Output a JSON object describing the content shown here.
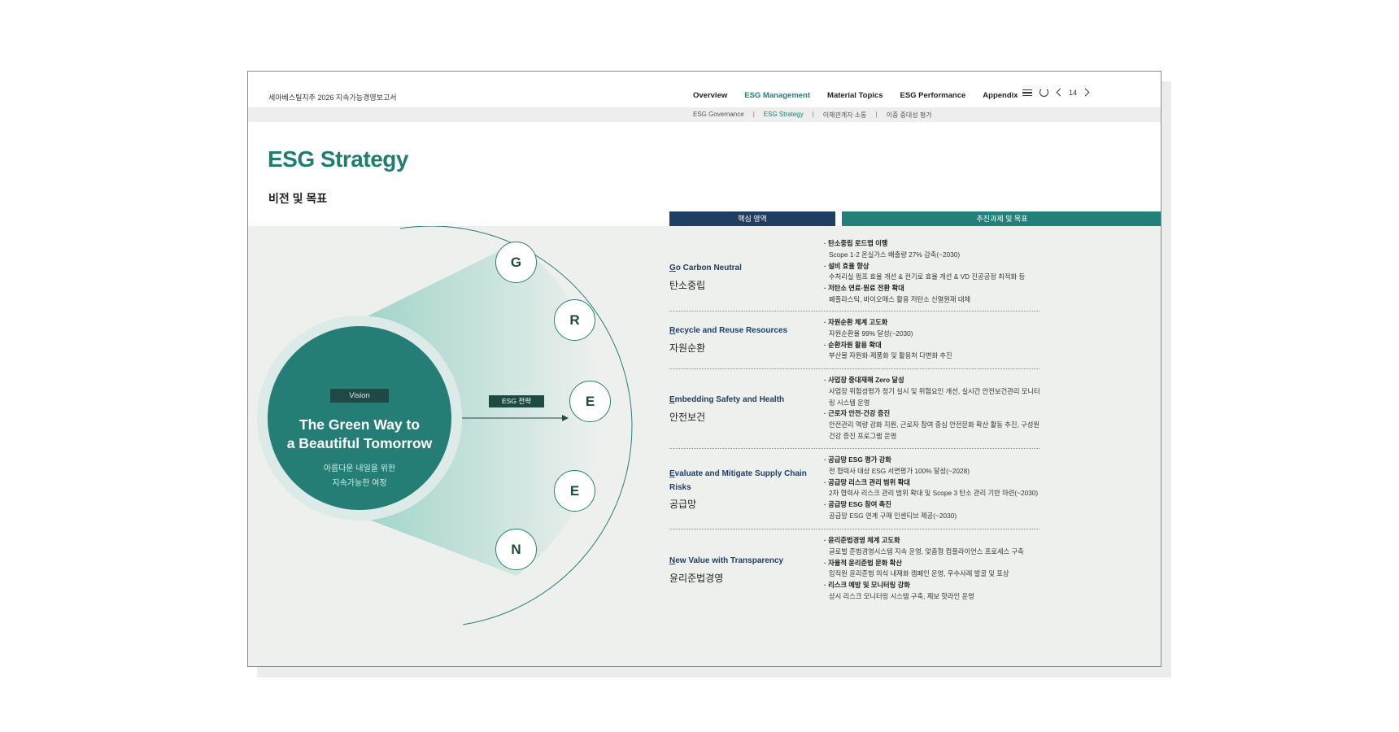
{
  "header": {
    "report_title": "세아베스틸지주 2026 지속가능경영보고서",
    "nav": [
      {
        "label": "Overview",
        "active": false
      },
      {
        "label": "ESG Management",
        "active": true
      },
      {
        "label": "Material Topics",
        "active": false
      },
      {
        "label": "ESG Performance",
        "active": false
      },
      {
        "label": "Appendix",
        "active": false
      }
    ],
    "page_number": "14",
    "icons": [
      "menu-icon",
      "refresh-icon",
      "chevron-left-icon",
      "chevron-right-icon"
    ]
  },
  "subnav": [
    {
      "label": "ESG Governance",
      "active": false
    },
    {
      "label": "ESG Strategy",
      "active": true
    },
    {
      "label": "이해관계자 소통",
      "active": false
    },
    {
      "label": "이중 중대성 평가",
      "active": false
    }
  ],
  "page": {
    "title": "ESG Strategy",
    "subtitle": "비전 및 목표"
  },
  "columns": {
    "core": "핵심 영역",
    "task": "추진과제 및 목표"
  },
  "vision": {
    "badge": "Vision",
    "title_line1": "The Green Way to",
    "title_line2": "a Beautiful Tomorrow",
    "sub_line1": "아름다운 내일을 위한",
    "sub_line2": "지속가능한 여정"
  },
  "strategy_tag": "ESG 전략",
  "letters": [
    "G",
    "R",
    "E",
    "E",
    "N"
  ],
  "rows": [
    {
      "en_first": "G",
      "en_rest": "o Carbon Neutral",
      "kr": "탄소중립",
      "items": [
        {
          "title": "· 탄소중립 로드맵 이행",
          "desc": "Scope 1·2  온실가스 배출량 27% 감축(~2030)"
        },
        {
          "title": "· 설비 효율 향상",
          "desc": "수처리실 펌프 효율 개선 & 전기로 효율 개선 & VD 진공공정 최적화 등"
        },
        {
          "title": "· 저탄소 연료·원료 전환 확대",
          "desc": "폐플라스틱, 바이오매스 활용 저탄소 신열원재 대체"
        }
      ]
    },
    {
      "en_first": "R",
      "en_rest": "ecycle and Reuse Resources",
      "kr": "자원순환",
      "items": [
        {
          "title": "· 자원순환 체계 고도화",
          "desc": "자원순환율 99% 달성(~2030)"
        },
        {
          "title": "· 순환자원 활용 확대",
          "desc": "부산물 자원화·제품화 및 활용처 다변화 추진"
        }
      ]
    },
    {
      "en_first": "E",
      "en_rest": "mbedding Safety and Health",
      "kr": "안전보건",
      "items": [
        {
          "title": "· 사업장 중대재해 Zero 달성",
          "desc": "사업장 위험성평가 정기 실시 및 위험요인 개선, 실시간 안전보건관리 모니터링 시스템 운영"
        },
        {
          "title": "· 근로자 안전·건강 증진",
          "desc": "안전관리 역량 강화 지원, 근로자 참여 중심 안전문화 확산 활동 추진, 구성원 건강 증진 프로그램 운영"
        }
      ]
    },
    {
      "en_first": "E",
      "en_rest": "valuate and Mitigate Supply Chain Risks",
      "kr": "공급망",
      "items": [
        {
          "title": "· 공급망 ESG 평가 강화",
          "desc": "전 협력사 대상 ESG 서면평가 100% 달성(~2028)"
        },
        {
          "title": "· 공급망 리스크 관리 범위 확대",
          "desc": "2차 협력사 리스크 관리 범위 확대 및 Scope 3 탄소 관리 기반 마련(~2030)"
        },
        {
          "title": "· 공급망 ESG 참여 촉진",
          "desc": "공급망 ESG 연계 구매 인센티브 제공(~2030)"
        }
      ]
    },
    {
      "en_first": "N",
      "en_rest": "ew Value with Transparency",
      "kr": "윤리준법경영",
      "items": [
        {
          "title": "· 윤리준법경영 체계 고도화",
          "desc": "글로벌 준법경영시스템 지속 운영, 맞춤형 컴플라이언스 프로세스 구축"
        },
        {
          "title": "· 자율적 윤리준법 문화 확산",
          "desc": "임직원 윤리준법 의식 내재화 캠페인 운영, 우수사례 발굴 및 포상"
        },
        {
          "title": "· 리스크 예방 및 모니터링 강화",
          "desc": "상시 리스크 모니터링 시스템 구축, 제보 핫라인 운영"
        }
      ]
    }
  ],
  "colors": {
    "brand_green": "#1f7d72",
    "navy": "#1f3e62",
    "teal_bar": "#237f79",
    "panel_bg": "#eef0ee"
  }
}
